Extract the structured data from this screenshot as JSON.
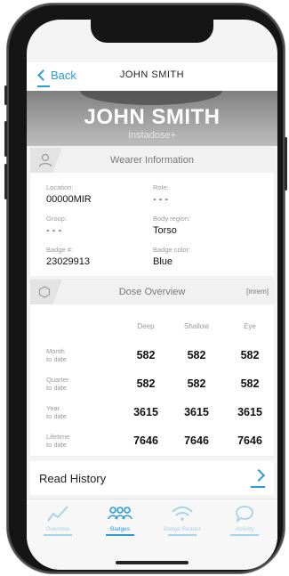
{
  "nav": {
    "back_label": "Back",
    "title": "JOHN SMITH"
  },
  "header": {
    "name": "JOHN SMITH",
    "subtitle": "Instadose+"
  },
  "wearer": {
    "title": "Wearer Information",
    "fields": {
      "location": {
        "label": "Location:",
        "value": "00000MIR"
      },
      "role": {
        "label": "Role:",
        "value": "- - -"
      },
      "group": {
        "label": "Group:",
        "value": "- - -"
      },
      "body_region": {
        "label": "Body region:",
        "value": "Torso"
      },
      "badge_num": {
        "label": "Badge #:",
        "value": "23029913"
      },
      "badge_color": {
        "label": "Badge color:",
        "value": "Blue"
      }
    }
  },
  "dose": {
    "title": "Dose Overview",
    "unit": "[mrem]",
    "columns": [
      "Deep",
      "Shallow",
      "Eye"
    ],
    "rows": [
      {
        "label_1": "Month",
        "label_2": "to date",
        "values": [
          "582",
          "582",
          "582"
        ]
      },
      {
        "label_1": "Quarter",
        "label_2": "to date",
        "values": [
          "582",
          "582",
          "582"
        ]
      },
      {
        "label_1": "Year",
        "label_2": "to date",
        "values": [
          "3615",
          "3615",
          "3615"
        ]
      },
      {
        "label_1": "Lifetime",
        "label_2": "to date",
        "values": [
          "7646",
          "7646",
          "7646"
        ]
      }
    ]
  },
  "history": {
    "label": "Read History"
  },
  "tabs": [
    {
      "label": "Overview",
      "icon": "chart-line-icon",
      "active": false
    },
    {
      "label": "Badges",
      "icon": "people-icon",
      "active": true
    },
    {
      "label": "Badge Reader",
      "icon": "wifi-icon",
      "active": false
    },
    {
      "label": "Activity",
      "icon": "chat-bubble-icon",
      "active": false
    }
  ],
  "colors": {
    "accent": "#2a9dd8",
    "accent_light": "#a6d3ea",
    "banner": "#9a9a9a"
  }
}
